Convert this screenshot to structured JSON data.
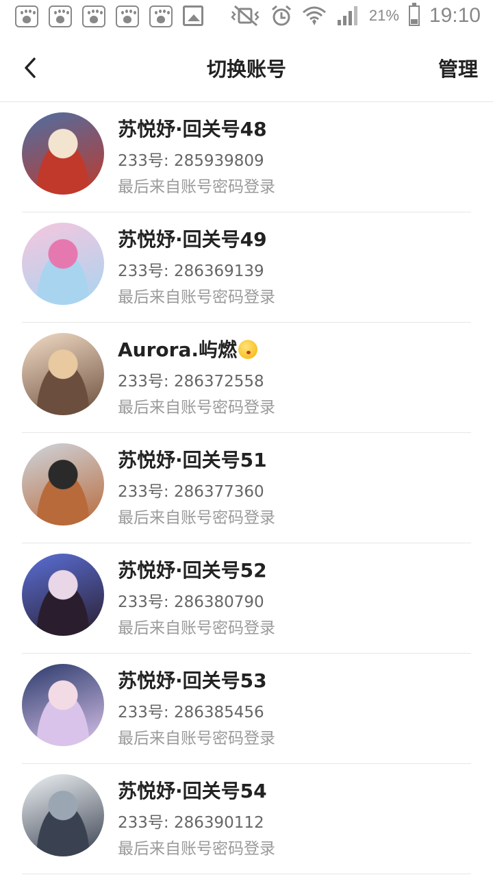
{
  "status_bar": {
    "notification_icons": [
      "baidu-icon",
      "baidu-icon",
      "baidu-icon",
      "baidu-icon",
      "baidu-icon",
      "gallery-icon"
    ],
    "battery": "21%",
    "time": "19:10"
  },
  "header": {
    "title": "切换账号",
    "manage": "管理"
  },
  "accounts": [
    {
      "name": "苏悦妤·回关号48",
      "uid": "233号: 285939809",
      "login": "最后来自账号密码登录",
      "avatar_colors": [
        "#4e6fa3",
        "#c0392b",
        "#f3e4d0"
      ]
    },
    {
      "name": "苏悦妤·回关号49",
      "uid": "233号: 286369139",
      "login": "最后来自账号密码登录",
      "avatar_colors": [
        "#f6c6de",
        "#a8d4f0",
        "#e678b0"
      ]
    },
    {
      "name": "Aurora.屿燃",
      "uid": "233号: 286372558",
      "login": "最后来自账号密码登录",
      "avatar_colors": [
        "#f2dcc6",
        "#6b4e3d",
        "#e8c9a0"
      ]
    },
    {
      "name": "苏悦妤·回关号51",
      "uid": "233号: 286377360",
      "login": "最后来自账号密码登录",
      "avatar_colors": [
        "#cfd5dd",
        "#b86a3a",
        "#2a2a2a"
      ]
    },
    {
      "name": "苏悦妤·回关号52",
      "uid": "233号: 286380790",
      "login": "最后来自账号密码登录",
      "avatar_colors": [
        "#5a6fd6",
        "#2a1e2e",
        "#e9d6e6"
      ]
    },
    {
      "name": "苏悦妤·回关号53",
      "uid": "233号: 286385456",
      "login": "最后来自账号密码登录",
      "avatar_colors": [
        "#2b3a6b",
        "#d9c3ea",
        "#f3dbe6"
      ]
    },
    {
      "name": "苏悦妤·回关号54",
      "uid": "233号: 286390112",
      "login": "最后来自账号密码登录",
      "avatar_colors": [
        "#eef2f5",
        "#3a4150",
        "#9aa6b2"
      ]
    }
  ]
}
